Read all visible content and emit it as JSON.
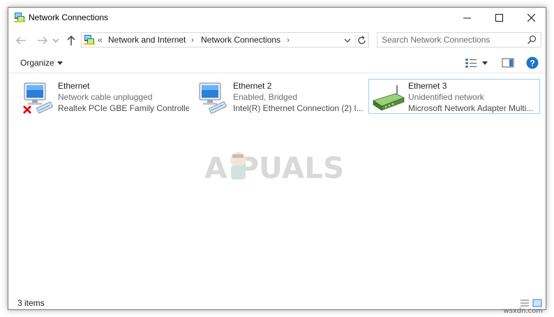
{
  "window": {
    "title": "Network Connections",
    "icons": {
      "app": "network-connections-icon",
      "minimize": "minimize-icon",
      "maximize": "maximize-icon",
      "close": "close-icon"
    }
  },
  "address_bar": {
    "overflow_glyph": "«",
    "breadcrumbs": [
      {
        "label": "Network and Internet"
      },
      {
        "label": "Network Connections"
      }
    ],
    "separator": "›",
    "nav_icons": [
      "back-arrow-icon",
      "forward-arrow-icon",
      "recent-locations-chevron-icon",
      "up-arrow-icon"
    ]
  },
  "search": {
    "placeholder": "Search Network Connections",
    "value": "",
    "icon": "search-icon"
  },
  "command_bar": {
    "organize_label": "Organize",
    "icons": [
      "change-view-icon",
      "view-options-chevron-icon",
      "preview-pane-icon",
      "help-icon"
    ]
  },
  "items": [
    {
      "name": "Ethernet",
      "status": "Network cable unplugged",
      "device": "Realtek PCIe GBE Family Controller",
      "icon": "network-adapter-disconnected-icon",
      "selected": false
    },
    {
      "name": "Ethernet 2",
      "status": "Enabled, Bridged",
      "device": "Intel(R) Ethernet Connection (2) I...",
      "icon": "network-adapter-icon",
      "selected": false
    },
    {
      "name": "Ethernet 3",
      "status": "Unidentified network",
      "device": "Microsoft Network Adapter Multi...",
      "icon": "network-router-icon",
      "selected": true
    }
  ],
  "status_bar": {
    "count_text": "3 items",
    "icons": [
      "details-view-icon",
      "large-icons-view-icon"
    ]
  },
  "watermarks": {
    "appuals": "A  PUALS",
    "site": "wsxdn.com"
  },
  "colors": {
    "selection_border": "#99d1ff",
    "help_blue": "#1e73c8",
    "secondary_text": "#6d6d6d"
  }
}
